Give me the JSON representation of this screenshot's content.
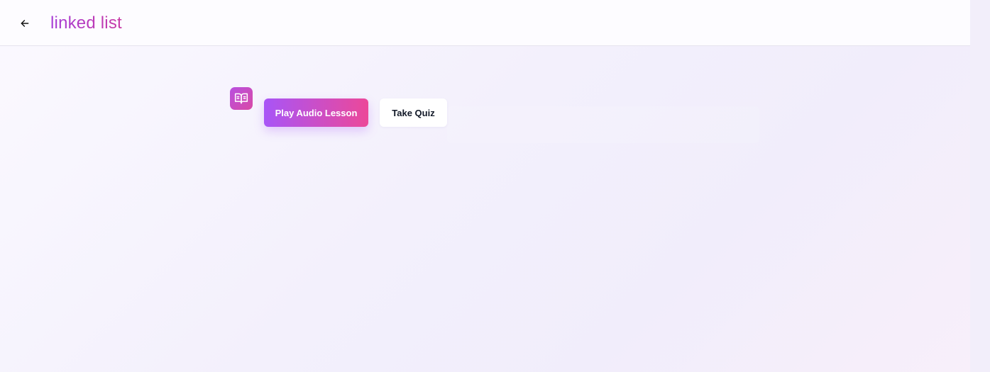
{
  "header": {
    "title": "linked list",
    "back_icon": "arrow-left-icon"
  },
  "lesson": {
    "badge_icon": "book-open-icon",
    "play_label": "Play Audio Lesson",
    "quiz_label": "Take Quiz"
  },
  "colors": {
    "title_gradient_start": "#a63cd6",
    "title_gradient_end": "#c83aa6",
    "primary_gradient_start": "#a855f7",
    "primary_gradient_end": "#ec4899",
    "secondary_bg": "#ffffff"
  }
}
